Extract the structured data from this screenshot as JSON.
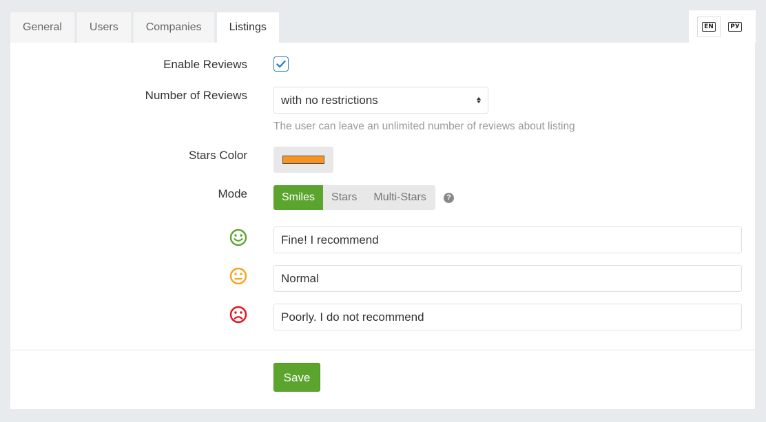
{
  "tabs": [
    {
      "label": "General"
    },
    {
      "label": "Users"
    },
    {
      "label": "Companies"
    },
    {
      "label": "Listings",
      "active": true
    }
  ],
  "languages": [
    {
      "code": "EN",
      "active": true
    },
    {
      "code": "РУ"
    }
  ],
  "form": {
    "enable_reviews": {
      "label": "Enable Reviews",
      "checked": true
    },
    "number_of_reviews": {
      "label": "Number of Reviews",
      "value": "with no restrictions",
      "hint": "The user can leave an unlimited number of reviews about listing"
    },
    "stars_color": {
      "label": "Stars Color",
      "value": "#f7941d"
    },
    "mode": {
      "label": "Mode",
      "options": [
        "Smiles",
        "Stars",
        "Multi-Stars"
      ],
      "selected": "Smiles"
    },
    "smiles": [
      {
        "icon": "happy-face-icon",
        "color": "#5ba52e",
        "value": "Fine! I recommend"
      },
      {
        "icon": "neutral-face-icon",
        "color": "#f7a21d",
        "value": "Normal"
      },
      {
        "icon": "sad-face-icon",
        "color": "#e8101a",
        "value": "Poorly. I do not recommend"
      }
    ]
  },
  "actions": {
    "save_label": "Save"
  },
  "colors": {
    "accent_green": "#5ba52e",
    "checkbox_blue": "#2a7fc4"
  }
}
